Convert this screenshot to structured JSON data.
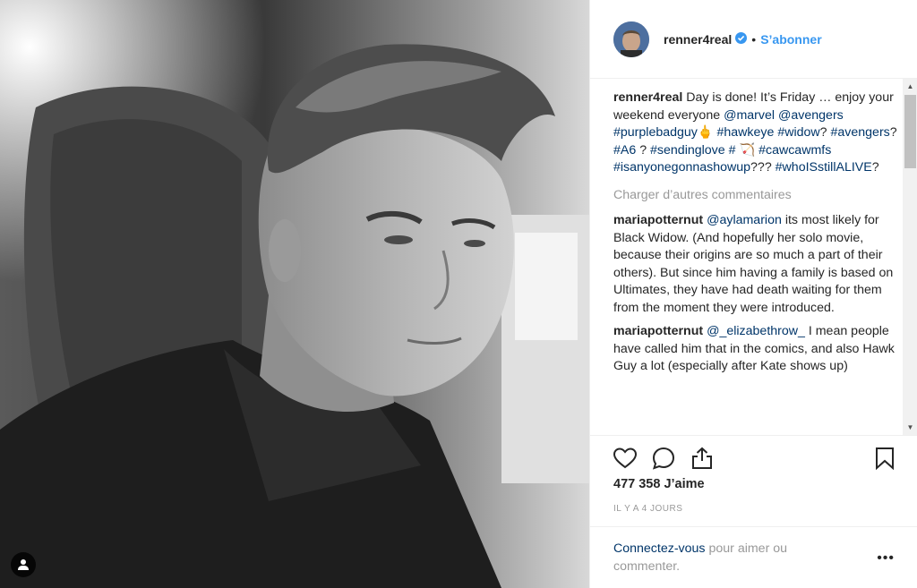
{
  "post": {
    "author": "renner4real",
    "follow_label": "S’abonner",
    "separator": "•",
    "caption": {
      "user": "renner4real",
      "text1": "Day is done! It’s Friday … enjoy your weekend everyone",
      "mention_marvel": "@marvel",
      "mention_avengers": "@avengers",
      "tag_purplebadguy": "#purplebadguy",
      "tag_hawkeye": "#hawkeye",
      "tag_widow": "#widow",
      "q1": "?",
      "tag_avengers": "#avengers",
      "q2": "?",
      "tag_a6": "#A6",
      "q3": "?",
      "tag_sendinglove": "#sendinglove",
      "tag_hash": "#",
      "tag_cawcawmfs": "#cawcawmfs",
      "tag_isanyone": "#isanyonegonnashowup",
      "qqq": "???",
      "tag_whoisstill": "#whoISstillALIVE",
      "q4": "?"
    },
    "load_more": "Charger d’autres commentaires",
    "comments": [
      {
        "user": "mariapotternut",
        "mention": "@aylamarion",
        "text": "its most likely for Black Widow. (And hopefully her solo movie, because their origins are so much a part of their others). But since him having a family is based on Ultimates, they have had death waiting for them from the moment they were introduced."
      },
      {
        "user": "mariapotternut",
        "mention": "@_elizabethrow_",
        "text": "I mean people have called him that in the comics, and also Hawk Guy a lot (especially after Kate shows up)"
      }
    ],
    "likes": "477 358 J’aime",
    "time": "IL Y A 4 JOURS",
    "login_link": "Connectez-vous",
    "login_rest": "pour aimer ou commenter.",
    "more_label": "•••",
    "icons": [
      "heart-icon",
      "comment-icon",
      "share-icon",
      "bookmark-icon",
      "user-tag-icon",
      "verified-icon"
    ],
    "colors": {
      "link": "#003569",
      "follow": "#3897f0",
      "muted": "#999999",
      "text": "#262626"
    }
  }
}
